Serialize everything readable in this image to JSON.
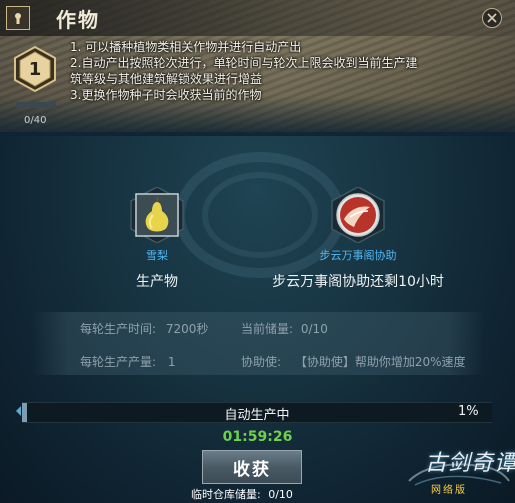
{
  "window": {
    "title": "作物"
  },
  "level": {
    "value": "1",
    "count_text": "0/40",
    "progress": 0.0
  },
  "description": {
    "lines": [
      "1. 可以播种植物类相关作物并进行自动产出",
      "2.自动产出按照轮次进行，单轮时间与轮次上限会收到当前生产建",
      "筑等级与其他建筑解锁效果进行增益",
      "3.更换作物种子时会收获当前的作物"
    ]
  },
  "product": {
    "name": "雪梨",
    "caption": "生产物",
    "icon": "pear-icon"
  },
  "helper": {
    "name": "步云万事阁协助",
    "caption": "步云万事阁协助还剩10小时",
    "icon": "helper-scroll-icon"
  },
  "info": {
    "time_label": "每轮生产时间:",
    "time_value": "7200秒",
    "stock_label": "当前储量:",
    "stock_value": "0/10",
    "output_label": "每轮生产产量:",
    "output_value": "1",
    "assist_label": "协助使:",
    "assist_value": "【协助使】帮助你增加20%速度"
  },
  "progress": {
    "label": "自动生产中",
    "percent_text": "1%",
    "fraction": 0.01
  },
  "timer": "01:59:26",
  "harvest_button": "收获",
  "storage": {
    "label": "临时仓库储量:",
    "value": "0/10"
  },
  "logo": {
    "icon": "game-logo",
    "text": "古剑奇谭",
    "subtitle": "网络版"
  },
  "colors": {
    "accent_blue": "#52b7f3",
    "timer_green": "#6fd14a"
  }
}
